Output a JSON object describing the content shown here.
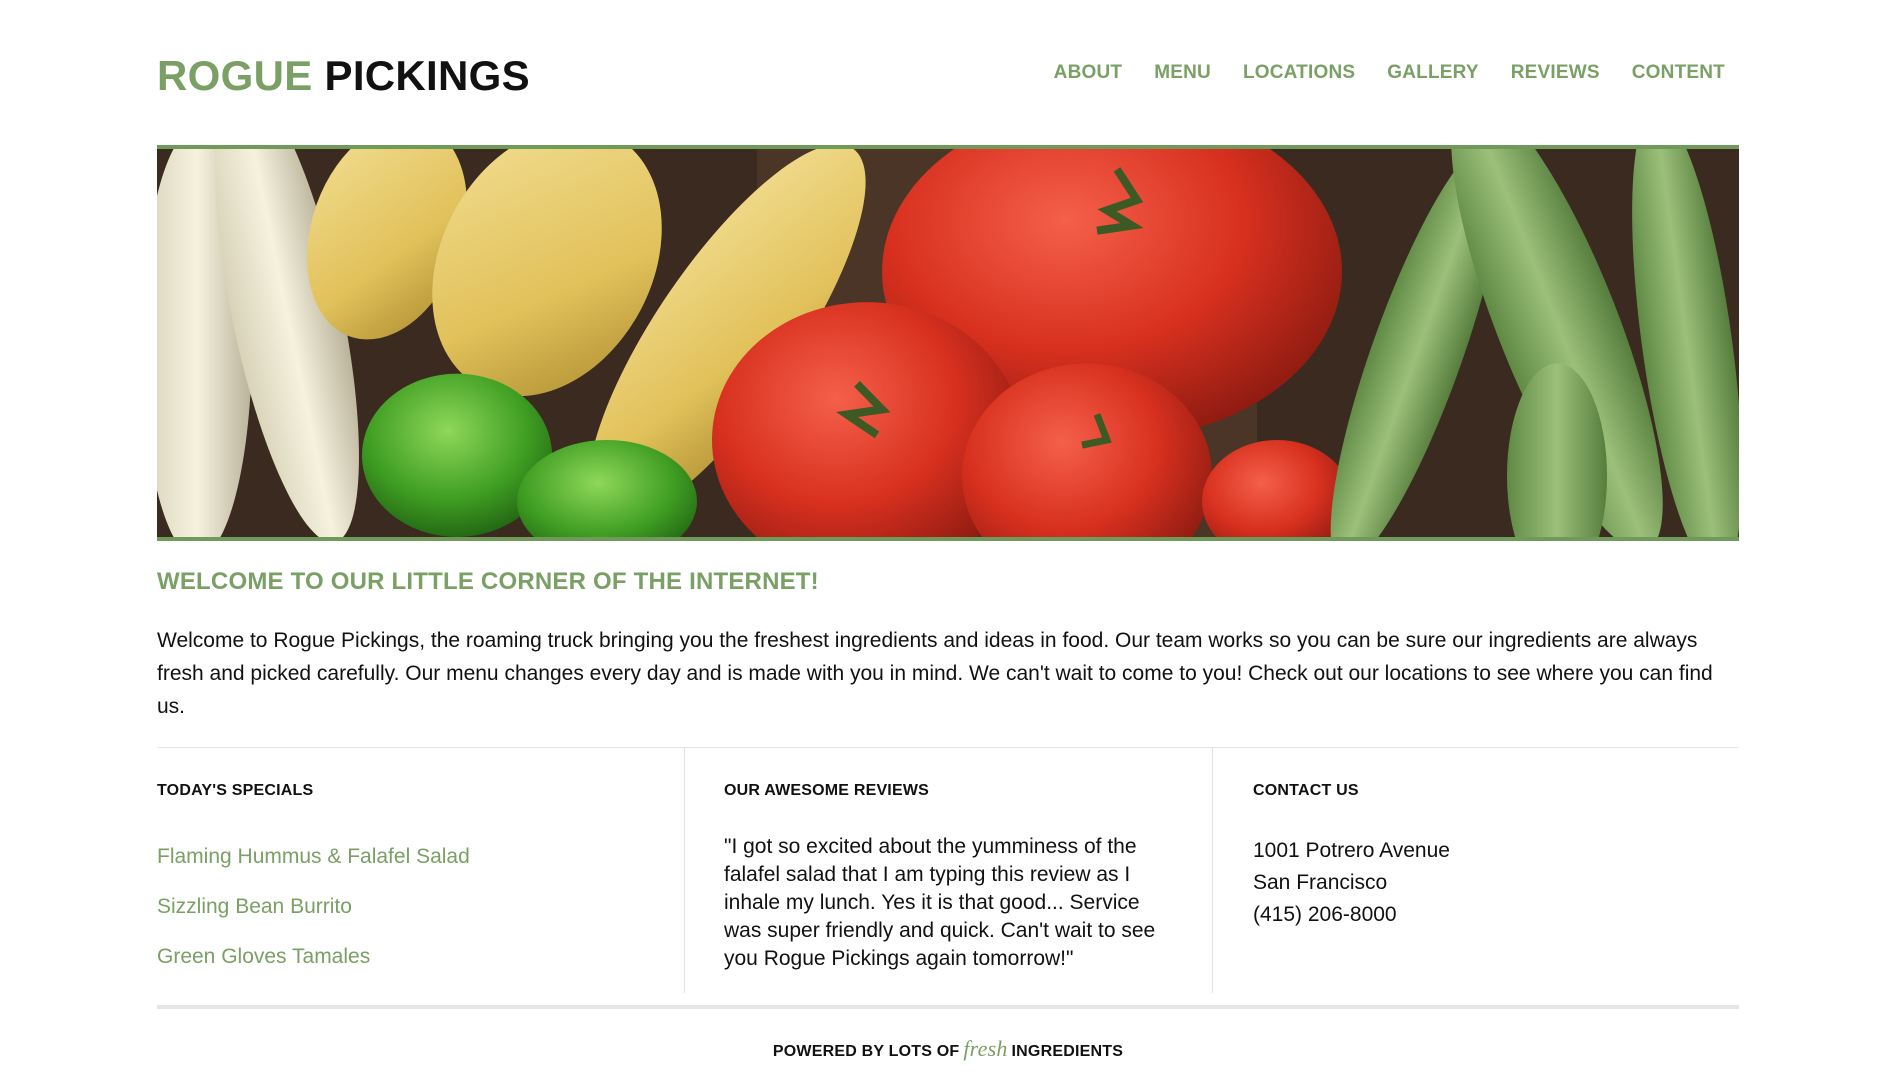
{
  "brand": {
    "part1": "ROGUE",
    "part2": "PICKINGS"
  },
  "nav": [
    "ABOUT",
    "MENU",
    "LOCATIONS",
    "GALLERY",
    "REVIEWS",
    "CONTENT"
  ],
  "hero": {
    "description": "vegetables banner: corn, yellow squash, green peppers, heirloom tomatoes, okra"
  },
  "welcome": {
    "title": "WELCOME TO OUR LITTLE CORNER OF THE INTERNET!",
    "text": "Welcome to Rogue Pickings, the roaming truck bringing you the freshest ingredients and ideas in food. Our team works so you can be sure our ingredients are always fresh and picked carefully. Our menu changes every day and is made with you in mind. We can't wait to come to you! Check out our locations to see where you can find us."
  },
  "specials": {
    "title": "TODAY'S SPECIALS",
    "items": [
      "Flaming Hummus & Falafel Salad",
      "Sizzling Bean Burrito",
      "Green Gloves Tamales"
    ]
  },
  "reviews": {
    "title": "OUR AWESOME REVIEWS",
    "text": "\"I got so excited about the yumminess of the falafel salad that I am typing this review as I inhale my lunch. Yes it is that good... Service was super friendly and quick. Can't wait to see you Rogue Pickings again tomorrow!\""
  },
  "contact": {
    "title": "CONTACT US",
    "address": "1001 Potrero Avenue",
    "city": "San Francisco",
    "phone": "(415) 206-8000"
  },
  "footer": {
    "before": "POWERED BY LOTS OF",
    "fresh": "fresh",
    "after": "INGREDIENTS"
  },
  "colors": {
    "accent": "#7aa065",
    "hero_border": "#6f9a5a",
    "text": "#111111"
  }
}
